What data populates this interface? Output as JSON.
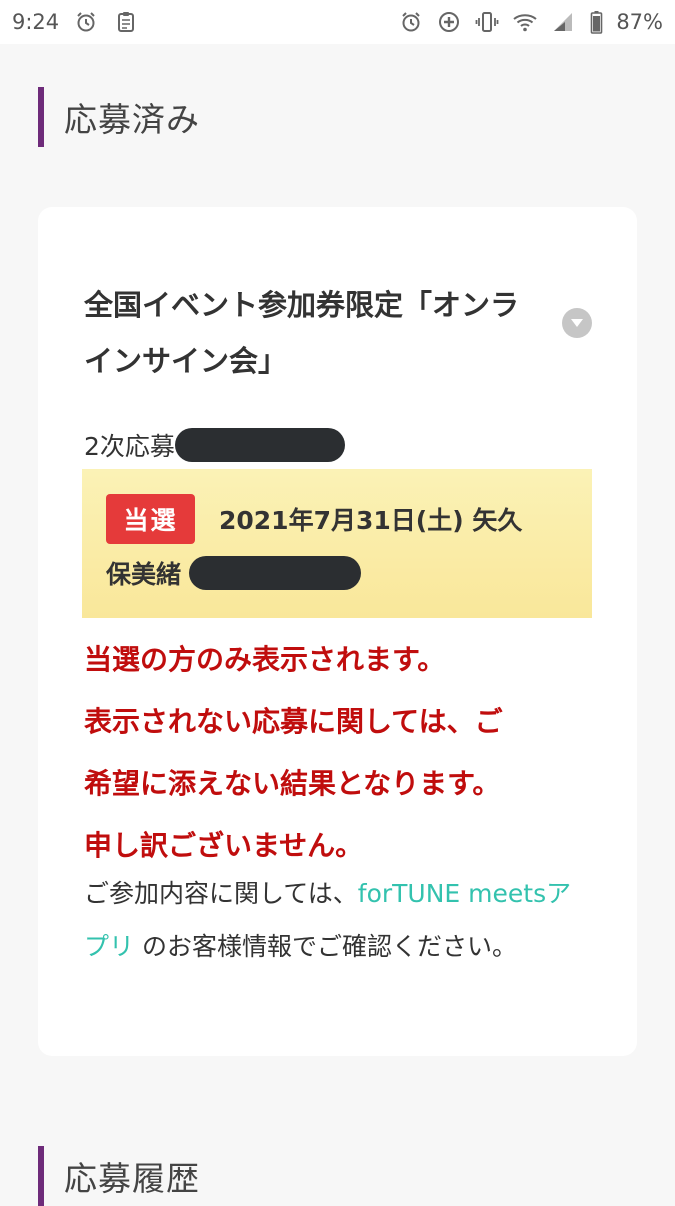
{
  "status_bar": {
    "time": "9:24",
    "battery": "87%",
    "left_icons": [
      "alarm-clock-icon",
      "clipboard-icon"
    ],
    "right_icons": [
      "alarm-icon",
      "data-saver-icon",
      "vibrate-icon",
      "wifi-icon",
      "signal-icon",
      "battery-icon"
    ]
  },
  "section_applied": {
    "title": "応募済み"
  },
  "card": {
    "event_title_line1": "全国イベント参加券限定「オンラ",
    "event_title_line2": "インサイン会」",
    "round_label": "2次応募",
    "win": {
      "badge": "当選",
      "date_text": "2021年7月31日(土) 矢久",
      "name_text": "保美緒"
    },
    "notice_lines": [
      "当選の方のみ表示されます。",
      "表示されない応募に関しては、ご",
      "希望に添えない結果となります。",
      "申し訳ございません。"
    ],
    "info_prefix": "ご参加内容に関しては、",
    "info_link": "forTUNE meetsアプリ",
    "info_suffix": " のお客様情報でご確認ください。"
  },
  "section_history": {
    "title": "応募履歴"
  },
  "colors": {
    "accent_bar": "#6e2b7a",
    "win_badge": "#e53a3a",
    "notice_red": "#c00d0d",
    "link_teal": "#33c2ae",
    "highlight_yellow": "#f9e79a"
  }
}
